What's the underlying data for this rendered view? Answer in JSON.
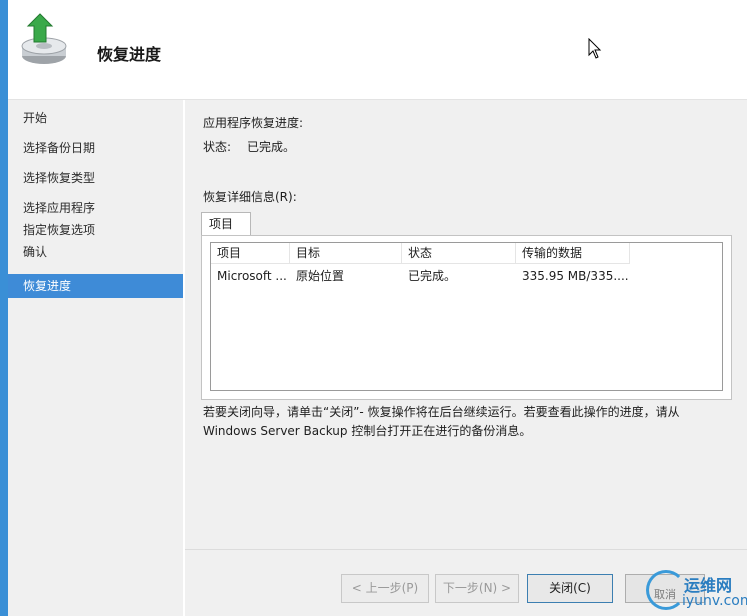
{
  "header": {
    "title": "恢复进度"
  },
  "sidebar": {
    "items": [
      {
        "label": "开始",
        "active": false
      },
      {
        "label": "选择备份日期",
        "active": false
      },
      {
        "label": "选择恢复类型",
        "active": false
      },
      {
        "label": "选择应用程序",
        "active": false
      },
      {
        "label": "指定恢复选项",
        "active": false
      },
      {
        "label": "确认",
        "active": false
      },
      {
        "label": "恢复进度",
        "active": true
      }
    ]
  },
  "main": {
    "progress_heading": "应用程序恢复进度:",
    "status_label": "状态:",
    "status_value": "已完成。",
    "details_label": "恢复详细信息(R):",
    "tab_label": "项目",
    "table": {
      "columns": [
        "项目",
        "目标",
        "状态",
        "传输的数据"
      ],
      "rows": [
        [
          "Microsoft ...",
          "原始位置",
          "已完成。",
          "335.95 MB/335...."
        ]
      ]
    },
    "info_line1": "若要关闭向导，请单击“关闭”- 恢复操作将在后台继续运行。若要查看此操作的进度，请从",
    "info_line2": "Windows Server Backup 控制台打开正在进行的备份消息。"
  },
  "buttons": {
    "prev": "< 上一步(P)",
    "next": "下一步(N) >",
    "close": "关闭(C)",
    "cancel": "取消"
  },
  "watermark": {
    "text_cn": "运维网",
    "text_en": "iyunv.com"
  },
  "colors": {
    "accent": "#3e8bd7",
    "border": "#3a8fd6"
  }
}
